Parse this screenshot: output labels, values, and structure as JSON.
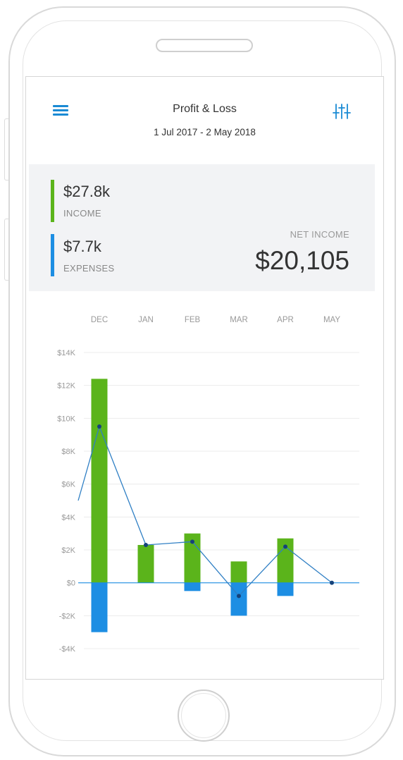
{
  "app": {
    "title": "Profit & Loss",
    "date_range": "1 Jul 2017 - 2 May 2018"
  },
  "icons": {
    "menu": "hamburger-menu-icon",
    "filter": "sliders-filter-icon"
  },
  "summary": {
    "income_value": "$27.8k",
    "income_label": "INCOME",
    "expenses_value": "$7.7k",
    "expenses_label": "EXPENSES",
    "net_income_label": "NET INCOME",
    "net_income_value": "$20,105"
  },
  "colors": {
    "accent": "#1a8ad4",
    "income": "#5bb41b",
    "expenses": "#1d8ee3",
    "summary_background": "#f2f3f5"
  },
  "chart_data": {
    "type": "bar",
    "categories": [
      "DEC",
      "JAN",
      "FEB",
      "MAR",
      "APR",
      "MAY"
    ],
    "series": [
      {
        "name": "INCOME",
        "kind": "bar",
        "color": "#5bb41b",
        "values": [
          12400,
          2300,
          3000,
          1300,
          2700,
          0
        ]
      },
      {
        "name": "EXPENSES",
        "kind": "bar",
        "color": "#1d8ee3",
        "values": [
          -3000,
          0,
          -500,
          -2000,
          -800,
          0
        ]
      },
      {
        "name": "NET INCOME",
        "kind": "line",
        "color": "#2f7fc4",
        "values": [
          9500,
          2300,
          2500,
          -800,
          2200,
          0
        ]
      }
    ],
    "y_ticks": [
      "$14K",
      "$12K",
      "$10K",
      "$8K",
      "$6K",
      "$4K",
      "$2K",
      "$0",
      "-$2K",
      "-$4K"
    ],
    "ylim": [
      -4000,
      14000
    ],
    "grid": true,
    "legend": "none"
  }
}
